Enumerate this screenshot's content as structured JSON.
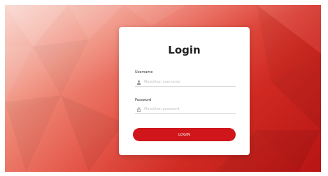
{
  "login": {
    "title": "Login",
    "username_label": "Username",
    "username_placeholder": "Masukkan username",
    "username_value": "",
    "password_label": "Password",
    "password_placeholder": "Masukkan password",
    "password_value": "",
    "button_label": "LOGIN"
  },
  "icons": {
    "username": "user-icon",
    "password": "lock-icon"
  },
  "colors": {
    "accent": "#d0161a",
    "background_light": "#f6c2b6",
    "background_dark": "#b71414",
    "card": "#ffffff"
  }
}
